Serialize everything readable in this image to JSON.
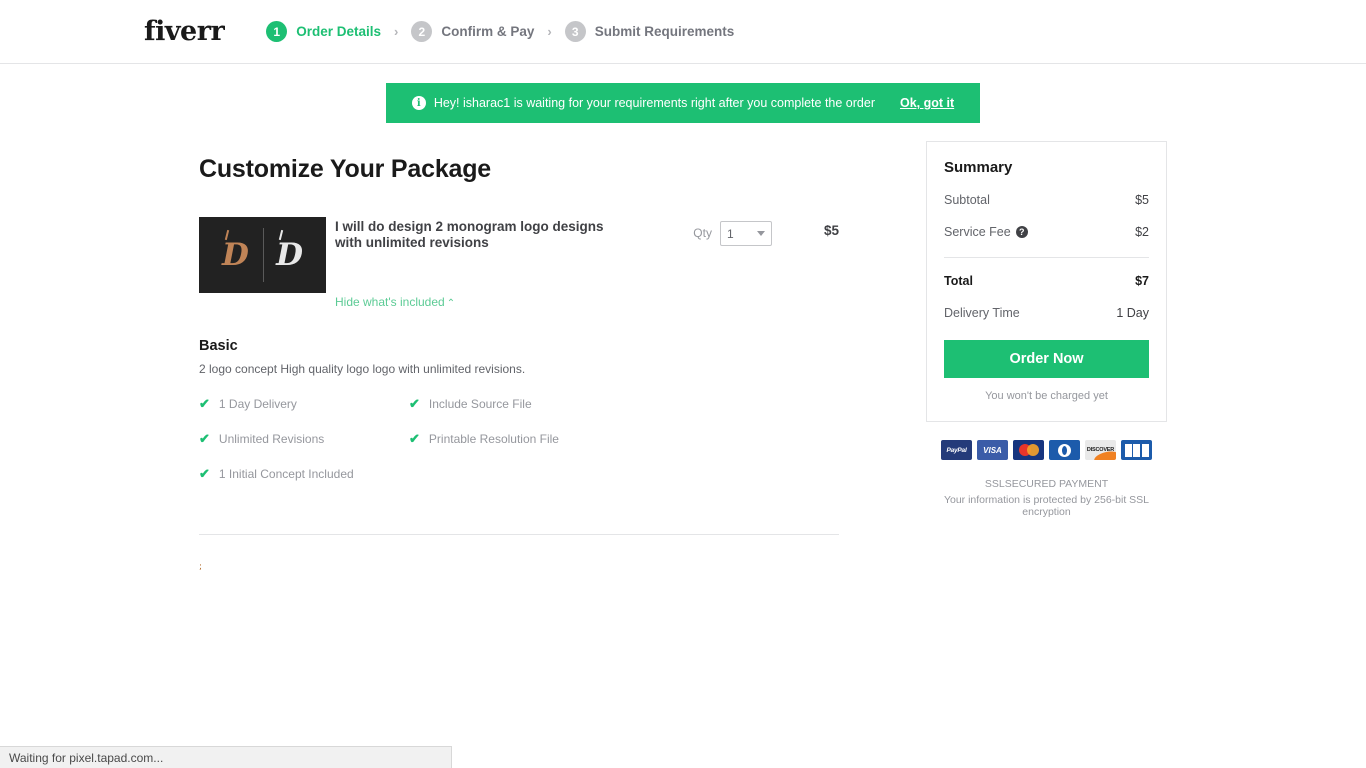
{
  "header": {
    "logo_text": "fiverr",
    "steps": [
      {
        "number": "1",
        "label": "Order Details",
        "state": "active"
      },
      {
        "number": "2",
        "label": "Confirm & Pay",
        "state": "inactive"
      },
      {
        "number": "3",
        "label": "Submit Requirements",
        "state": "inactive"
      }
    ],
    "separator": "›"
  },
  "banner": {
    "icon_char": "i",
    "message": "Hey! isharac1 is waiting for your requirements right after you complete the order",
    "action_label": "Ok, got it",
    "background_color": "#1dbf73"
  },
  "main": {
    "page_title": "Customize Your Package",
    "gig": {
      "title": "I will do design 2 monogram logo designs with unlimited revisions",
      "toggle_label": "Hide what's included",
      "toggle_chevron": "⌃",
      "qty_label": "Qty",
      "qty_value": "1",
      "price": "$5"
    },
    "package": {
      "name": "Basic",
      "description": "2 logo concept High quality logo logo with unlimited revisions.",
      "features": [
        "1 Day Delivery",
        "Include Source File",
        "Unlimited Revisions",
        "Printable Resolution File",
        "1 Initial Concept Included"
      ],
      "check_char": "✔"
    },
    "stray_artifact": ";"
  },
  "summary": {
    "title": "Summary",
    "rows": [
      {
        "label": "Subtotal",
        "value": "$5",
        "help": false
      },
      {
        "label": "Service Fee",
        "value": "$2",
        "help": true
      }
    ],
    "help_char": "?",
    "total": {
      "label": "Total",
      "value": "$7"
    },
    "delivery": {
      "label": "Delivery Time",
      "value": "1 Day"
    },
    "order_button": "Order Now",
    "charge_note": "You won't be charged yet",
    "payment_methods": [
      {
        "name": "paypal-icon",
        "label": "PayPal"
      },
      {
        "name": "visa-icon",
        "label": "VISA"
      },
      {
        "name": "mastercard-icon",
        "label": ""
      },
      {
        "name": "diners-club-icon",
        "label": ""
      },
      {
        "name": "discover-icon",
        "label": "DISCOVER"
      },
      {
        "name": "jcb-icon",
        "label": ""
      }
    ],
    "ssl_title": "SSLSECURED PAYMENT",
    "ssl_subtitle": "Your information is protected by 256-bit SSL encryption"
  },
  "browser": {
    "status_text": "Waiting for pixel.tapad.com..."
  },
  "colors": {
    "brand_green": "#1dbf73",
    "muted_text": "#95979d",
    "dark_text": "#404145"
  }
}
